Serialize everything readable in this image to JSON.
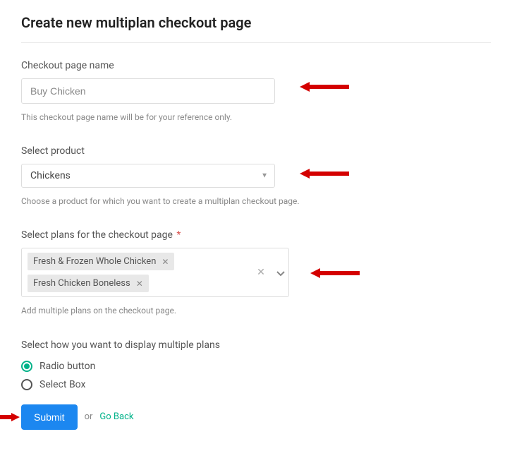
{
  "title": "Create new multiplan checkout page",
  "fields": {
    "pageName": {
      "label": "Checkout page name",
      "value": "Buy Chicken",
      "helper": "This checkout page name will be for your reference only."
    },
    "product": {
      "label": "Select product",
      "value": "Chickens",
      "helper": "Choose a product for which you want to create a multiplan checkout page."
    },
    "plans": {
      "label": "Select plans for the checkout page",
      "required": "*",
      "tags": [
        "Fresh & Frozen Whole Chicken",
        "Fresh Chicken Boneless"
      ],
      "helper": "Add multiple plans on the checkout page."
    },
    "display": {
      "label": "Select how you want to display multiple plans",
      "options": [
        "Radio button",
        "Select Box"
      ],
      "selected": 0
    }
  },
  "actions": {
    "submit": "Submit",
    "or": "or",
    "goBack": "Go Back"
  }
}
